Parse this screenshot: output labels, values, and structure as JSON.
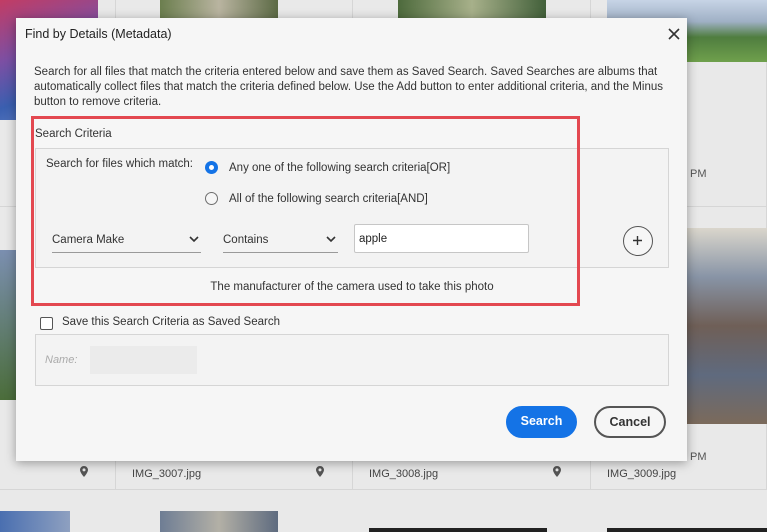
{
  "dialog": {
    "title": "Find by Details (Metadata)",
    "description": "Search for all files that match the criteria entered below and save them as Saved Search. Saved Searches are albums that automatically collect files that match the criteria defined below. Use the Add button to enter additional criteria, and the Minus button to remove criteria.",
    "criteria_label": "Search Criteria",
    "match_label": "Search for files which match:",
    "option_any": "Any one of the following search criteria[OR]",
    "option_all": "All of the following search criteria[AND]",
    "selected_option": "any",
    "field_select": "Camera Make",
    "operator_select": "Contains",
    "value_input": "apple",
    "hint": "The manufacturer of the camera used to take this photo",
    "save_checkbox_label": "Save this Search Criteria as Saved Search",
    "save_checked": false,
    "name_label": "Name:",
    "name_value": "",
    "search_button": "Search",
    "cancel_button": "Cancel"
  },
  "background": {
    "files": [
      "IMG_3007.jpg",
      "IMG_3008.jpg",
      "IMG_3009.jpg"
    ],
    "time_suffix_1": "PM",
    "time_suffix_2": "PM"
  },
  "colors": {
    "accent": "#1473e6",
    "highlight": "#e34850"
  },
  "icons": [
    "close-icon",
    "chevron-down-icon",
    "plus-icon",
    "location-pin-icon"
  ]
}
